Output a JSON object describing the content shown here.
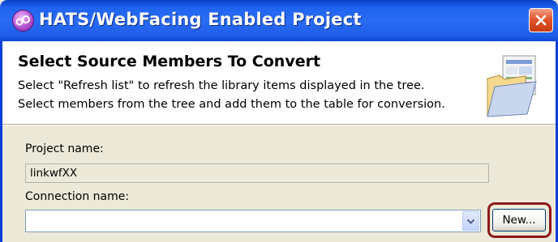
{
  "window": {
    "title": "HATS/WebFacing Enabled Project",
    "icon": "hats-webfacing-app-icon",
    "close_icon": "close-icon"
  },
  "header": {
    "title": "Select Source Members To Convert",
    "description_line1": "Select \"Refresh list\" to refresh the library items displayed in the tree.",
    "description_line2": "Select members from the tree and add them to the table for conversion.",
    "image": "wizard-folder-icon"
  },
  "form": {
    "project_name_label": "Project name:",
    "project_name_value": "linkwfXX",
    "connection_name_label": "Connection name:",
    "connection_name_value": "",
    "new_button_label": "New..."
  },
  "colors": {
    "titlebar": "#2a6cf3",
    "dialog_bg": "#ece9d8",
    "highlight_box": "#8b1a1a",
    "close_button": "#e2552d"
  }
}
